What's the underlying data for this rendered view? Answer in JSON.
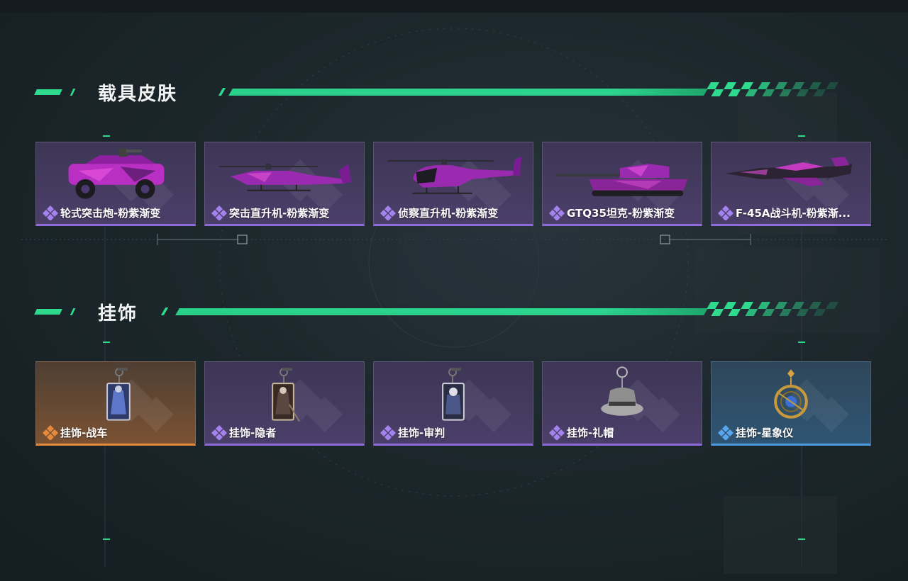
{
  "sections": [
    {
      "title": "载具皮肤",
      "items": [
        {
          "label": "轮式突击炮-粉紫渐变",
          "rarity": "purple",
          "icon": "armored-vehicle-icon"
        },
        {
          "label": "突击直升机-粉紫渐变",
          "rarity": "purple",
          "icon": "attack-helicopter-icon"
        },
        {
          "label": "侦察直升机-粉紫渐变",
          "rarity": "purple",
          "icon": "scout-helicopter-icon"
        },
        {
          "label": "GTQ35坦克-粉紫渐变",
          "rarity": "purple",
          "icon": "tank-icon"
        },
        {
          "label": "F-45A战斗机-粉紫渐...",
          "rarity": "purple",
          "icon": "fighter-jet-icon"
        }
      ]
    },
    {
      "title": "挂饰",
      "items": [
        {
          "label": "挂饰-战车",
          "rarity": "orange",
          "icon": "tarot-card-charm-icon"
        },
        {
          "label": "挂饰-隐者",
          "rarity": "purple",
          "icon": "tarot-card-charm-icon"
        },
        {
          "label": "挂饰-审判",
          "rarity": "purple",
          "icon": "tarot-card-charm-icon"
        },
        {
          "label": "挂饰-礼帽",
          "rarity": "purple",
          "icon": "top-hat-charm-icon"
        },
        {
          "label": "挂饰-星象仪",
          "rarity": "blue",
          "icon": "astrolabe-charm-icon"
        }
      ]
    }
  ],
  "colors": {
    "accent": "#2fd98e",
    "rarity_purple": "#8f6bdb",
    "rarity_orange": "#e58a3d",
    "rarity_blue": "#4e9be0"
  }
}
